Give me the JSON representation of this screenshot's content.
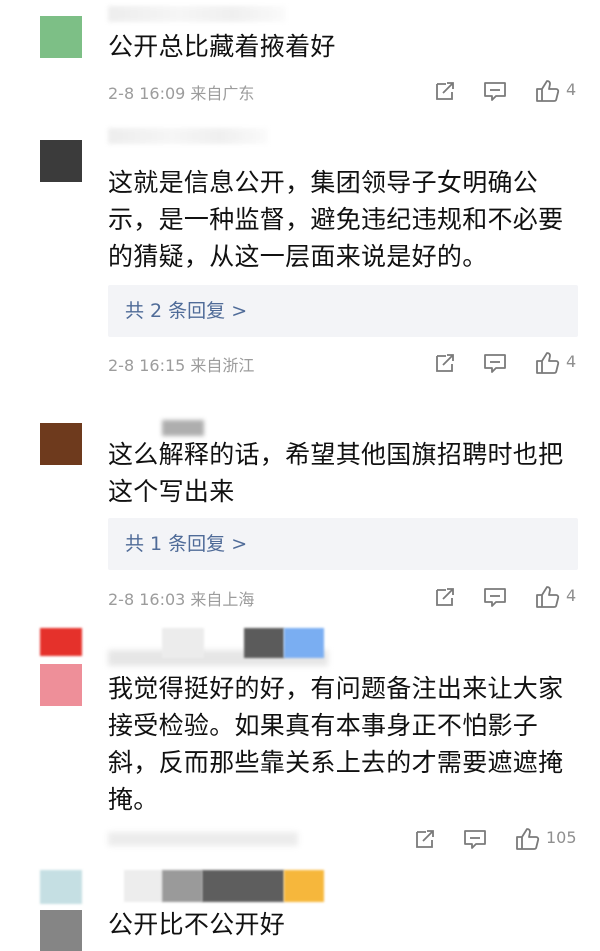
{
  "comments": [
    {
      "text": "公开总比藏着掖着好",
      "date": "2-8 16:09",
      "location": "来自广东",
      "likes": "4",
      "avatar_color": "#7dbf86"
    },
    {
      "text": "这就是信息公开，集团领导子女明确公示，是一种监督，避免违纪违规和不必要的猜疑，从这一层面来说是好的。",
      "reply_label": "共 2 条回复 >",
      "date": "2-8 16:15",
      "location": "来自浙江",
      "likes": "4",
      "avatar_color": "#3b3b3b"
    },
    {
      "text": "这么解释的话，希望其他国旗招聘时也把这个写出来",
      "reply_label": "共 1 条回复 >",
      "date": "2-8 16:03",
      "location": "来自上海",
      "likes": "4",
      "avatar_color": "#6e3a1d"
    },
    {
      "text": "我觉得挺好的好，有问题备注出来让大家接受检验。如果真有本事身正不怕影子斜，反而那些靠关系上去的才需要遮遮掩掩。",
      "likes": "105",
      "avatar_color": "#ee8f99"
    },
    {
      "text": "公开比不公开好",
      "avatar_color": "#858585"
    }
  ],
  "icons": {
    "share": "share-icon",
    "comment": "comment-icon",
    "like": "thumbs-up-icon"
  }
}
